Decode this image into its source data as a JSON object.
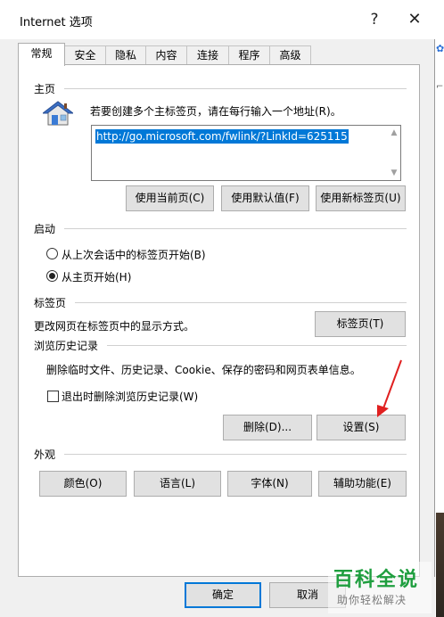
{
  "window": {
    "title": "Internet 选项",
    "help": "?",
    "close": "✕"
  },
  "tabs": [
    {
      "label": "常规",
      "active": true
    },
    {
      "label": "安全"
    },
    {
      "label": "隐私"
    },
    {
      "label": "内容"
    },
    {
      "label": "连接"
    },
    {
      "label": "程序"
    },
    {
      "label": "高级"
    }
  ],
  "home": {
    "title": "主页",
    "desc": "若要创建多个主标签页，请在每行输入一个地址(R)。",
    "url": "http://go.microsoft.com/fwlink/?LinkId=625115",
    "btn_current": "使用当前页(C)",
    "btn_default": "使用默认值(F)",
    "btn_newtab": "使用新标签页(U)"
  },
  "startup": {
    "title": "启动",
    "option1": "从上次会话中的标签页开始(B)",
    "option2": "从主页开始(H)",
    "selected": 2
  },
  "tabs_section": {
    "title": "标签页",
    "desc": "更改网页在标签页中的显示方式。",
    "btn": "标签页(T)"
  },
  "history": {
    "title": "浏览历史记录",
    "desc": "删除临时文件、历史记录、Cookie、保存的密码和网页表单信息。",
    "checkbox_label": "退出时删除浏览历史记录(W)",
    "checkbox_checked": false,
    "btn_delete": "删除(D)...",
    "btn_settings": "设置(S)"
  },
  "appearance": {
    "title": "外观",
    "btn_colors": "颜色(O)",
    "btn_languages": "语言(L)",
    "btn_fonts": "字体(N)",
    "btn_accessibility": "辅助功能(E)"
  },
  "footer": {
    "ok": "确定",
    "cancel": "取消"
  },
  "watermark": {
    "main": "百科全说",
    "sub": "助你轻松解决"
  },
  "colors": {
    "accent": "#0078d7",
    "annotation_arrow": "#e02020",
    "watermark_green": "#1f9e3f"
  }
}
